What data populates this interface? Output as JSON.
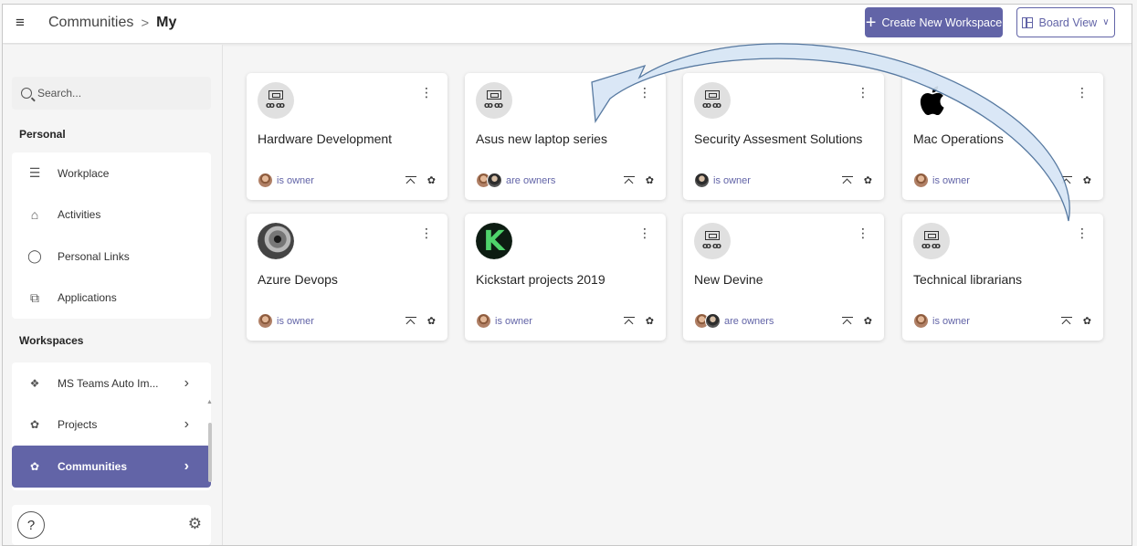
{
  "header": {
    "breadcrumb_root": "Communities",
    "breadcrumb_sep": ">",
    "breadcrumb_current": "My",
    "create_button": "Create New Workspace",
    "view_button": "Board View"
  },
  "sidebar": {
    "search_placeholder": "Search...",
    "personal_label": "Personal",
    "personal_items": [
      {
        "label": "Workplace",
        "icon": "list-icon"
      },
      {
        "label": "Activities",
        "icon": "home-icon"
      },
      {
        "label": "Personal Links",
        "icon": "person-icon"
      },
      {
        "label": "Applications",
        "icon": "copy-icon"
      }
    ],
    "workspaces_label": "Workspaces",
    "workspace_items": [
      {
        "label": "MS Teams Auto Im...",
        "icon": "teams-icon"
      },
      {
        "label": "Projects",
        "icon": "community-icon"
      },
      {
        "label": "Communities",
        "icon": "community-icon",
        "active": true
      }
    ],
    "help": "?"
  },
  "cards": [
    {
      "title": "Hardware Development",
      "owners": "is owner",
      "avatar": "team"
    },
    {
      "title": "Asus new laptop series",
      "owners": "are owners",
      "avatar": "team"
    },
    {
      "title": "Security Assesment Solutions",
      "owners": "is owner",
      "avatar": "team"
    },
    {
      "title": "Mac Operations",
      "owners": "is owner",
      "avatar": "apple"
    },
    {
      "title": "Azure Devops",
      "owners": "is owner",
      "avatar": "photo"
    },
    {
      "title": "Kickstart projects 2019",
      "owners": "is owner",
      "avatar": "k-logo"
    },
    {
      "title": "New Devine",
      "owners": "are owners",
      "avatar": "team"
    },
    {
      "title": "Technical librarians",
      "owners": "is owner",
      "avatar": "team"
    }
  ],
  "colors": {
    "accent": "#6264a7",
    "arrow_fill": "#d7e6f6",
    "arrow_stroke": "#4a6f9a"
  }
}
